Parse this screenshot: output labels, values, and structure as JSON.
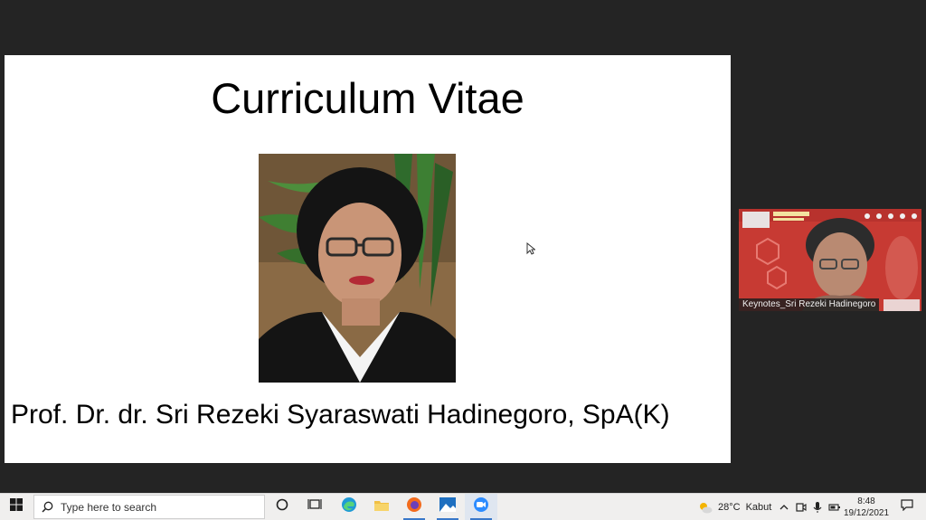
{
  "slide": {
    "title": "Curriculum Vitae",
    "caption": "Prof. Dr. dr. Sri Rezeki Syaraswati Hadinegoro, SpA(K)"
  },
  "video": {
    "participant_name": "Keynotes_Sri Rezeki Hadinegoro"
  },
  "taskbar": {
    "search_placeholder": "Type here to search",
    "weather_temp": "28°C",
    "weather_desc": "Kabut",
    "time": "8:48",
    "date": "19/12/2021",
    "accent_color": "#3a78c9"
  },
  "icons": {
    "start": "windows-logo-icon",
    "search": "search-icon",
    "cortana": "cortana-icon",
    "task_view": "task-view-icon",
    "edge": "edge-icon",
    "file_explorer": "folder-icon",
    "firefox": "firefox-icon",
    "photos": "photos-icon",
    "zoom": "zoom-icon"
  }
}
